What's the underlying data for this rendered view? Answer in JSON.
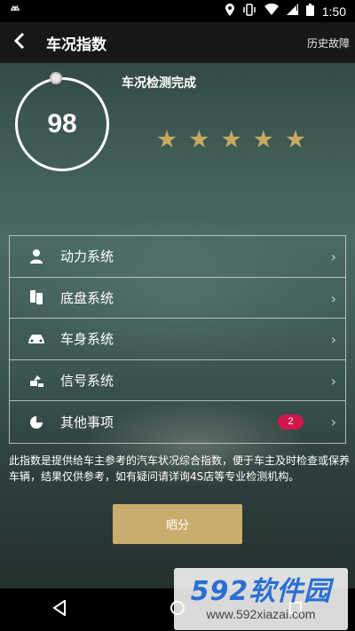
{
  "status_bar": {
    "time": "1:50"
  },
  "header": {
    "title": "车况指数",
    "history_label": "历史故障"
  },
  "score": {
    "value": "98",
    "status": "车况检测完成",
    "rating_stars": 5,
    "star_color": "#c8a95e"
  },
  "systems": [
    {
      "label": "动力系统",
      "icon": "driver-icon",
      "badge": ""
    },
    {
      "label": "底盘系统",
      "icon": "chassis-icon",
      "badge": ""
    },
    {
      "label": "车身系统",
      "icon": "car-icon",
      "badge": ""
    },
    {
      "label": "信号系统",
      "icon": "signal-icon",
      "badge": ""
    },
    {
      "label": "其他事项",
      "icon": "pie-icon",
      "badge": "2"
    }
  ],
  "disclaimer": "此指数是提供给车主参考的汽车状况综合指数，便于车主及时检查或保养车辆，结果仅供参考，如有疑问请详询4S店等专业检测机构。",
  "share_button": {
    "label": "晒分",
    "color": "#c8ad6d"
  },
  "watermark": {
    "logo": "592软件园",
    "url": "www.592xiazai.com"
  },
  "colors": {
    "badge": "#d0164a",
    "header_bg": "#181818"
  }
}
